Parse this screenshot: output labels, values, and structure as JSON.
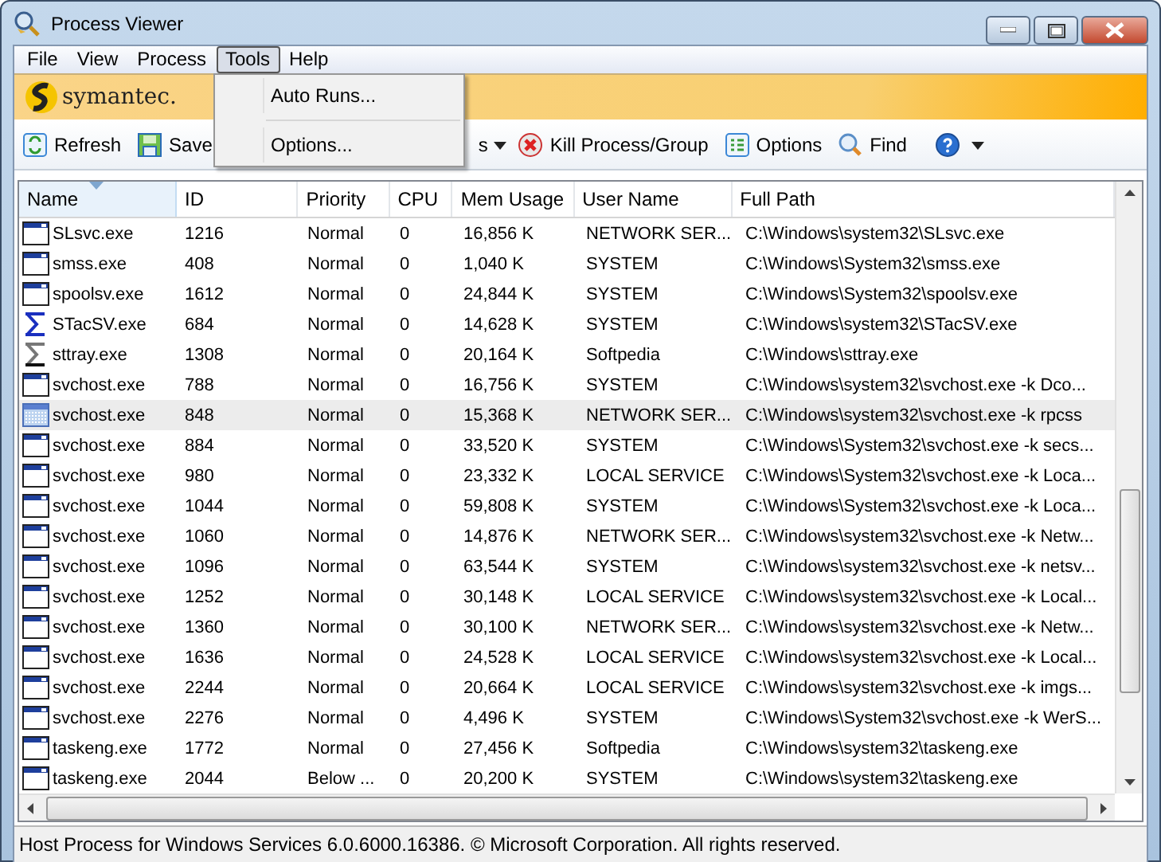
{
  "window": {
    "title": "Process Viewer"
  },
  "menu_bar": [
    {
      "label": "File",
      "selected": false
    },
    {
      "label": "View",
      "selected": false
    },
    {
      "label": "Process",
      "selected": false
    },
    {
      "label": "Tools",
      "selected": true
    },
    {
      "label": "Help",
      "selected": false
    }
  ],
  "open_menu": {
    "items": [
      {
        "label": "Auto Runs..."
      },
      {
        "label": "Options..."
      }
    ]
  },
  "banner": {
    "logo_text": "symantec."
  },
  "toolbar": [
    {
      "kind": "refresh",
      "label": "Refresh"
    },
    {
      "kind": "save",
      "label": "Save"
    },
    {
      "kind": "partial",
      "label": "s"
    },
    {
      "kind": "kill",
      "label": "Kill Process/Group"
    },
    {
      "kind": "options",
      "label": "Options"
    },
    {
      "kind": "find",
      "label": "Find"
    },
    {
      "kind": "help"
    }
  ],
  "table": {
    "columns": [
      {
        "label": "Name",
        "sorted": true
      },
      {
        "label": "ID",
        "sorted": false
      },
      {
        "label": "Priority",
        "sorted": false
      },
      {
        "label": "CPU",
        "sorted": false
      },
      {
        "label": "Mem Usage",
        "sorted": false
      },
      {
        "label": "User Name",
        "sorted": false
      },
      {
        "label": "Full Path",
        "sorted": false
      }
    ],
    "rows": [
      {
        "selected": false,
        "cells": [
          "SLsvc.exe",
          "1216",
          "Normal",
          "0",
          "16,856 K",
          "NETWORK SER...",
          "C:\\Windows\\system32\\SLsvc.exe"
        ]
      },
      {
        "selected": false,
        "cells": [
          "smss.exe",
          "408",
          "Normal",
          "0",
          "1,040 K",
          "SYSTEM",
          "C:\\Windows\\System32\\smss.exe"
        ]
      },
      {
        "selected": false,
        "cells": [
          "spoolsv.exe",
          "1612",
          "Normal",
          "0",
          "24,844 K",
          "SYSTEM",
          "C:\\Windows\\System32\\spoolsv.exe"
        ]
      },
      {
        "selected": false,
        "cells": [
          "STacSV.exe",
          "684",
          "Normal",
          "0",
          "14,628 K",
          "SYSTEM",
          "C:\\Windows\\system32\\STacSV.exe"
        ]
      },
      {
        "selected": false,
        "cells": [
          "sttray.exe",
          "1308",
          "Normal",
          "0",
          "20,164 K",
          "Softpedia",
          "C:\\Windows\\sttray.exe"
        ]
      },
      {
        "selected": false,
        "cells": [
          "svchost.exe",
          "788",
          "Normal",
          "0",
          "16,756 K",
          "SYSTEM",
          "C:\\Windows\\system32\\svchost.exe -k Dco..."
        ]
      },
      {
        "selected": true,
        "cells": [
          "svchost.exe",
          "848",
          "Normal",
          "0",
          "15,368 K",
          "NETWORK SER...",
          "C:\\Windows\\system32\\svchost.exe -k rpcss"
        ]
      },
      {
        "selected": false,
        "cells": [
          "svchost.exe",
          "884",
          "Normal",
          "0",
          "33,520 K",
          "SYSTEM",
          "C:\\Windows\\System32\\svchost.exe -k secs..."
        ]
      },
      {
        "selected": false,
        "cells": [
          "svchost.exe",
          "980",
          "Normal",
          "0",
          "23,332 K",
          "LOCAL SERVICE",
          "C:\\Windows\\System32\\svchost.exe -k Loca..."
        ]
      },
      {
        "selected": false,
        "cells": [
          "svchost.exe",
          "1044",
          "Normal",
          "0",
          "59,808 K",
          "SYSTEM",
          "C:\\Windows\\System32\\svchost.exe -k Loca..."
        ]
      },
      {
        "selected": false,
        "cells": [
          "svchost.exe",
          "1060",
          "Normal",
          "0",
          "14,876 K",
          "NETWORK SER...",
          "C:\\Windows\\system32\\svchost.exe -k Netw..."
        ]
      },
      {
        "selected": false,
        "cells": [
          "svchost.exe",
          "1096",
          "Normal",
          "0",
          "63,544 K",
          "SYSTEM",
          "C:\\Windows\\system32\\svchost.exe -k netsv..."
        ]
      },
      {
        "selected": false,
        "cells": [
          "svchost.exe",
          "1252",
          "Normal",
          "0",
          "30,148 K",
          "LOCAL SERVICE",
          "C:\\Windows\\system32\\svchost.exe -k Local..."
        ]
      },
      {
        "selected": false,
        "cells": [
          "svchost.exe",
          "1360",
          "Normal",
          "0",
          "30,100 K",
          "NETWORK SER...",
          "C:\\Windows\\system32\\svchost.exe -k Netw..."
        ]
      },
      {
        "selected": false,
        "cells": [
          "svchost.exe",
          "1636",
          "Normal",
          "0",
          "24,528 K",
          "LOCAL SERVICE",
          "C:\\Windows\\system32\\svchost.exe -k Local..."
        ]
      },
      {
        "selected": false,
        "cells": [
          "svchost.exe",
          "2244",
          "Normal",
          "0",
          "20,664 K",
          "LOCAL SERVICE",
          "C:\\Windows\\system32\\svchost.exe -k imgs..."
        ]
      },
      {
        "selected": false,
        "cells": [
          "svchost.exe",
          "2276",
          "Normal",
          "0",
          "4,496 K",
          "SYSTEM",
          "C:\\Windows\\System32\\svchost.exe -k WerS..."
        ]
      },
      {
        "selected": false,
        "cells": [
          "taskeng.exe",
          "1772",
          "Normal",
          "0",
          "27,456 K",
          "Softpedia",
          "C:\\Windows\\system32\\taskeng.exe"
        ]
      },
      {
        "selected": false,
        "cells": [
          "taskeng.exe",
          "2044",
          "Below ...",
          "0",
          "20,200 K",
          "SYSTEM",
          "C:\\Windows\\system32\\taskeng.exe"
        ]
      }
    ]
  },
  "status_bar": {
    "text": "Host Process for Windows Services 6.0.6000.16386.  © Microsoft Corporation. All rights reserved."
  }
}
